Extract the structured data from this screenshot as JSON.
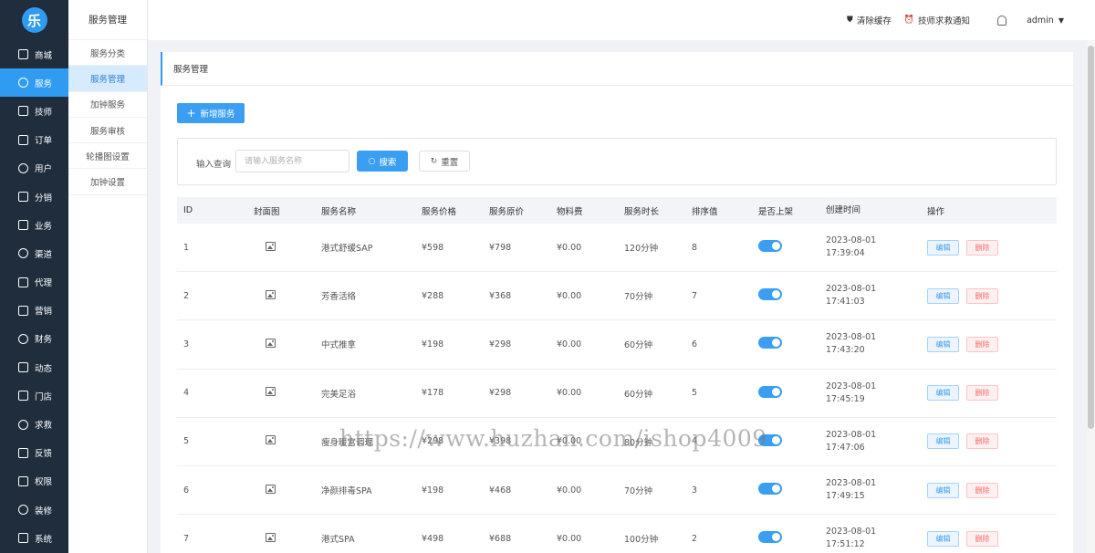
{
  "nav": {
    "logo_char": "乐",
    "items": [
      {
        "label": "商城",
        "icon": "lock-icon"
      },
      {
        "label": "服务",
        "icon": "list-icon"
      },
      {
        "label": "技师",
        "icon": "clock-icon"
      },
      {
        "label": "订单",
        "icon": "doc-icon"
      },
      {
        "label": "用户",
        "icon": "user-icon"
      },
      {
        "label": "分销",
        "icon": "share-icon"
      },
      {
        "label": "业务",
        "icon": "person-icon"
      },
      {
        "label": "渠道",
        "icon": "home-icon"
      },
      {
        "label": "代理",
        "icon": "agent-icon"
      },
      {
        "label": "营销",
        "icon": "gift-icon"
      },
      {
        "label": "财务",
        "icon": "money-icon"
      },
      {
        "label": "动态",
        "icon": "compass-icon"
      },
      {
        "label": "门店",
        "icon": "store-icon"
      },
      {
        "label": "求救",
        "icon": "bell-icon"
      },
      {
        "label": "反馈",
        "icon": "feedback-icon"
      },
      {
        "label": "权限",
        "icon": "key-icon"
      },
      {
        "label": "装修",
        "icon": "brush-icon"
      },
      {
        "label": "系统",
        "icon": "gear-icon"
      }
    ]
  },
  "sub": {
    "title": "服务管理",
    "items": [
      "服务分类",
      "服务管理",
      "加钟服务",
      "服务审核",
      "轮播图设置",
      "加钟设置"
    ]
  },
  "topbar": {
    "clear_cache": "清除缓存",
    "sos_notice": "技师求救通知",
    "user": "admin"
  },
  "card": {
    "title": "服务管理",
    "add_button": "新增服务"
  },
  "search": {
    "label": "输入查询",
    "placeholder": "请输入服务名称",
    "search_button": "搜索",
    "reset_button": "重置"
  },
  "table": {
    "headers": [
      "ID",
      "封面图",
      "服务名称",
      "服务价格",
      "服务原价",
      "物料费",
      "服务时长",
      "排序值",
      "是否上架",
      "创建时间",
      "操作"
    ],
    "edit_label": "编辑",
    "delete_label": "删除",
    "rows": [
      {
        "id": "1",
        "name": "港式舒缓SAP",
        "price": "¥598",
        "orig": "¥798",
        "mat": "¥0.00",
        "dur": "120分钟",
        "sort": "8",
        "date": "2023-08-01",
        "time": "17:39:04"
      },
      {
        "id": "2",
        "name": "芳香活络",
        "price": "¥288",
        "orig": "¥368",
        "mat": "¥0.00",
        "dur": "70分钟",
        "sort": "7",
        "date": "2023-08-01",
        "time": "17:41:03"
      },
      {
        "id": "3",
        "name": "中式推拿",
        "price": "¥198",
        "orig": "¥298",
        "mat": "¥0.00",
        "dur": "60分钟",
        "sort": "6",
        "date": "2023-08-01",
        "time": "17:43:20"
      },
      {
        "id": "4",
        "name": "完美足浴",
        "price": "¥178",
        "orig": "¥298",
        "mat": "¥0.00",
        "dur": "60分钟",
        "sort": "5",
        "date": "2023-08-01",
        "time": "17:45:19"
      },
      {
        "id": "5",
        "name": "瘦身暖宫调理",
        "price": "¥298",
        "orig": "¥398",
        "mat": "¥0.00",
        "dur": "80分钟",
        "sort": "4",
        "date": "2023-08-01",
        "time": "17:47:06"
      },
      {
        "id": "6",
        "name": "净颜排毒SPA",
        "price": "¥198",
        "orig": "¥468",
        "mat": "¥0.00",
        "dur": "70分钟",
        "sort": "3",
        "date": "2023-08-01",
        "time": "17:49:15"
      },
      {
        "id": "7",
        "name": "港式SPA",
        "price": "¥498",
        "orig": "¥688",
        "mat": "¥0.00",
        "dur": "100分钟",
        "sort": "2",
        "date": "2023-08-01",
        "time": "17:51:12"
      }
    ]
  },
  "watermark": "https://www.huzhan.com/ishop4009",
  "colors": {
    "accent": "#3a9ef2",
    "nav_bg": "#1f2d3d",
    "danger": "#f56c6c"
  }
}
